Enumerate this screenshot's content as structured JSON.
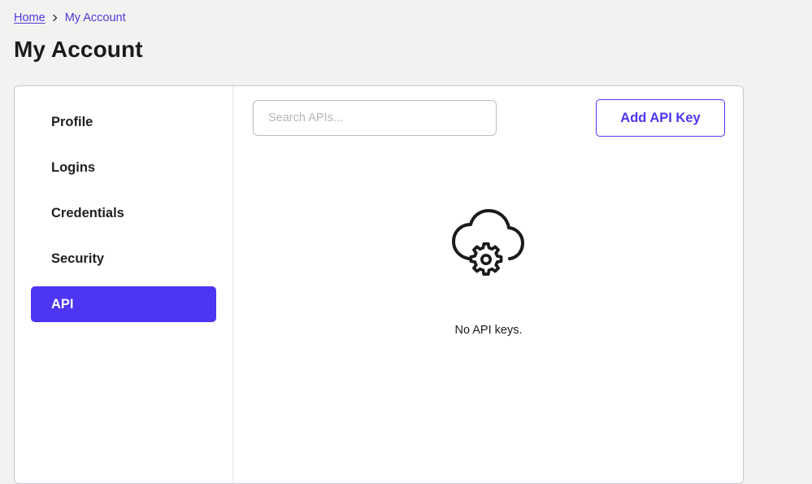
{
  "breadcrumb": {
    "home": "Home",
    "separator_icon": "chevron-right-icon",
    "current": "My Account"
  },
  "page": {
    "title": "My Account"
  },
  "sidebar": {
    "items": [
      {
        "label": "Profile",
        "active": false
      },
      {
        "label": "Logins",
        "active": false
      },
      {
        "label": "Credentials",
        "active": false
      },
      {
        "label": "Security",
        "active": false
      },
      {
        "label": "API",
        "active": true
      }
    ]
  },
  "main": {
    "search": {
      "placeholder": "Search APIs...",
      "value": ""
    },
    "add_button_label": "Add API Key",
    "empty_state": {
      "icon": "cloud-gear-icon",
      "message": "No API keys."
    }
  },
  "colors": {
    "accent": "#4c35f4",
    "link": "#4f3bd9",
    "background": "#f3f2f1",
    "card": "#ffffff"
  }
}
